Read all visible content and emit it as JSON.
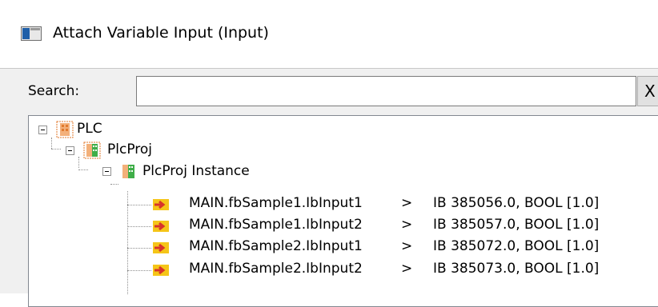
{
  "window": {
    "title": "Attach Variable Input (Input)",
    "icon": "window-icon"
  },
  "search": {
    "label": "Search:",
    "value": "",
    "placeholder": "",
    "clear_label": "X"
  },
  "tree": {
    "root": {
      "label": "PLC",
      "icon": "plc-icon"
    },
    "project": {
      "label": "PlcProj",
      "icon": "plc-project-icon"
    },
    "instance": {
      "label": "PlcProj Instance",
      "icon": "plc-instance-icon"
    },
    "variables": [
      {
        "name": "MAIN.fbSample1.IbInput1",
        "arrow": ">",
        "mapping": "IB 385056.0, BOOL [1.0]"
      },
      {
        "name": "MAIN.fbSample1.IbInput2",
        "arrow": ">",
        "mapping": "IB 385057.0, BOOL [1.0]"
      },
      {
        "name": "MAIN.fbSample2.IbInput1",
        "arrow": ">",
        "mapping": "IB 385072.0, BOOL [1.0]"
      },
      {
        "name": "MAIN.fbSample2.IbInput2",
        "arrow": ">",
        "mapping": "IB 385073.0, BOOL [1.0]"
      }
    ]
  },
  "colors": {
    "window_bg": "#f0f0f0",
    "titlebar_bg": "#ffffff",
    "plc_icon_orange": "#e07a2e",
    "plc_icon_green": "#3fae49",
    "var_icon_yellow": "#f5c518",
    "var_icon_red": "#d8332a"
  }
}
